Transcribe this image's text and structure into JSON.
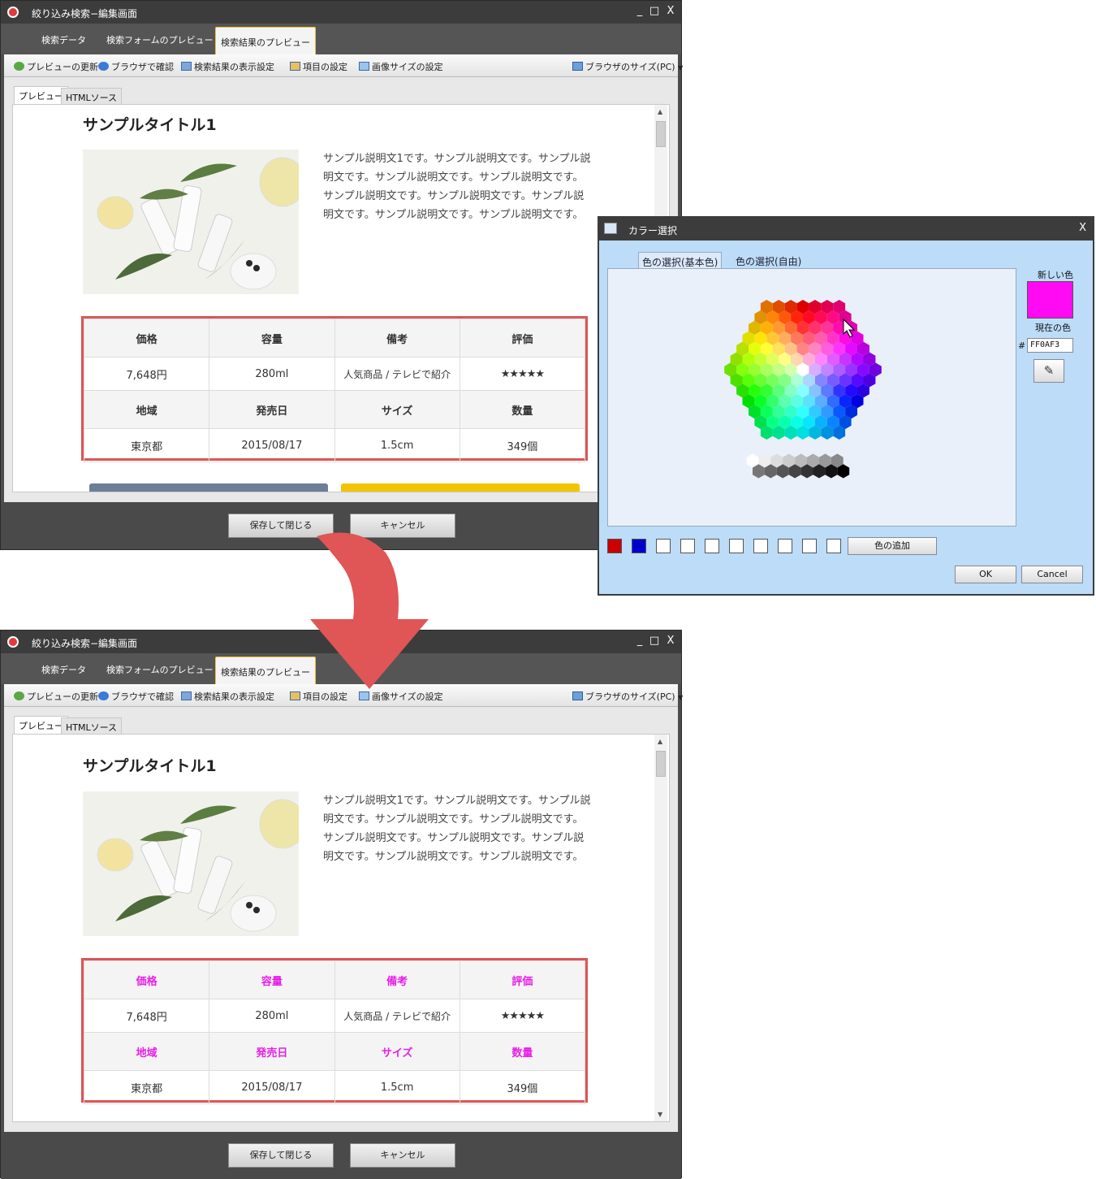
{
  "window": {
    "title": "絞り込み検索−編集画面",
    "controls": [
      "_",
      "□",
      "X"
    ],
    "tabs": [
      "検索データ",
      "検索フォームのプレビュー",
      "検索結果のプレビュー"
    ],
    "toolbar": {
      "refresh": "プレビューの更新",
      "browser_check": "ブラウザで確認",
      "result_display": "検索結果の表示設定",
      "item_settings": "項目の設定",
      "image_size": "画像サイズの設定",
      "browser_size": "ブラウザのサイズ(PC)"
    },
    "subtabs": [
      "プレビュー",
      "HTMLソース"
    ],
    "footer": {
      "save": "保存して閉じる",
      "cancel": "キャンセル"
    }
  },
  "preview": {
    "title": "サンプルタイトル1",
    "description": "サンプル説明文1です。サンプル説明文です。サンプル説明文です。サンプル説明文です。サンプル説明文です。サンプル説明文です。サンプル説明文です。サンプル説明文です。サンプル説明文です。サンプル説明文です。",
    "headers_row1": [
      "価格",
      "容量",
      "備考",
      "評価"
    ],
    "values_row1": {
      "price": "7,648円",
      "volume": "280ml",
      "note": "人気商品 / テレビで紹介",
      "rating": "★★★★★"
    },
    "rating_stars": 5,
    "headers_row2": [
      "地域",
      "発売日",
      "サイズ",
      "数量"
    ],
    "values_row2": [
      "東京都",
      "2015/08/17",
      "1.5cm",
      "349個"
    ]
  },
  "dialog": {
    "title": "カラー選択",
    "close": "X",
    "tabs": [
      "色の選択(基本色)",
      "色の選択(自由)"
    ],
    "new_color_label": "新しい色",
    "current_color_label": "現在の色",
    "hash": "#",
    "hex_value": "FF0AF3",
    "add_color": "色の追加",
    "ok": "OK",
    "cancel": "Cancel",
    "custom_swatches": [
      "#cc0000",
      "#0000cc",
      "#ffffff",
      "#ffffff",
      "#ffffff",
      "#ffffff",
      "#ffffff",
      "#ffffff",
      "#ffffff",
      "#ffffff"
    ]
  },
  "colors": {
    "new_color": "#ff0af3",
    "header_pink": "#e81ee8",
    "highlight_border": "#dd5555",
    "arrow": "#e05555"
  }
}
